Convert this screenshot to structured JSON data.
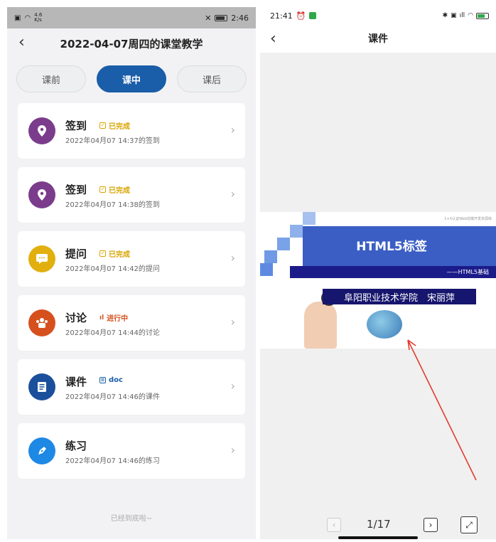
{
  "left": {
    "statusbar": {
      "speed_value": "4.6",
      "speed_unit": "K/s",
      "time": "2:46",
      "battery": "100"
    },
    "title": "2022-04-07周四的课堂教学",
    "tabs": [
      {
        "label": "课前"
      },
      {
        "label": "课中"
      },
      {
        "label": "课后"
      }
    ],
    "active_tab": "课中",
    "items": [
      {
        "name": "签到",
        "status": "已完成",
        "time": "2022年04月07 14:37的签到",
        "icon": "location-icon",
        "icon_color": "#7b3c8c",
        "status_color": "#d9a400"
      },
      {
        "name": "签到",
        "status": "已完成",
        "time": "2022年04月07 14:38的签到",
        "icon": "location-icon",
        "icon_color": "#7b3c8c",
        "status_color": "#d9a400"
      },
      {
        "name": "提问",
        "status": "已完成",
        "time": "2022年04月07 14:42的提问",
        "icon": "question-icon",
        "icon_color": "#e1b00e",
        "status_color": "#d9a400"
      },
      {
        "name": "讨论",
        "status": "进行中",
        "time": "2022年04月07 14:44的讨论",
        "icon": "discussion-icon",
        "icon_color": "#d6501e",
        "status_color": "#d6501e"
      },
      {
        "name": "课件",
        "status": "doc",
        "time": "2022年04月07 14:46的课件",
        "icon": "document-icon",
        "icon_color": "#1b4f9c",
        "status_color": "#1a5da8"
      },
      {
        "name": "练习",
        "status": "",
        "time": "2022年04月07 14:46的练习",
        "icon": "pen-icon",
        "icon_color": "#1e88e5",
        "status_color": "#1a5da8"
      }
    ],
    "footer": "已经到底啦~"
  },
  "right": {
    "statusbar": {
      "time": "21:41",
      "battery": "67"
    },
    "title": "课件",
    "slide": {
      "title": "HTML5标签",
      "subtitle": "——HTML5基础",
      "names": "阜阳职业技术学院　宋丽萍",
      "corner": "1+X认证Web前端开发资源库"
    },
    "page_indicator": "1/17"
  }
}
